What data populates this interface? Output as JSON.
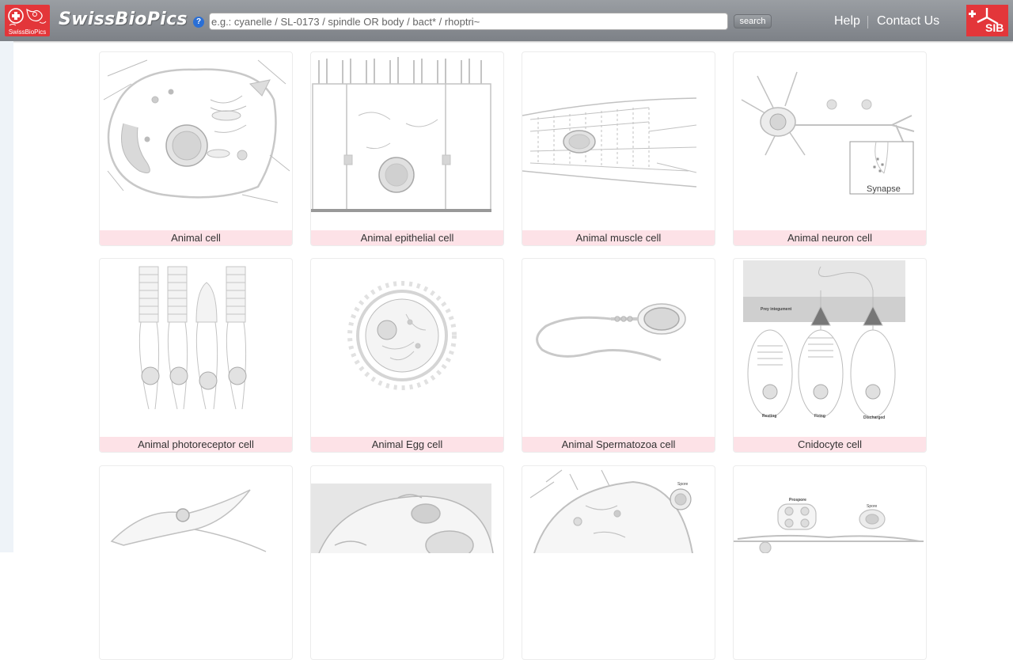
{
  "header": {
    "logo_caption": "SwissBioPics",
    "site_title": "SwissBioPics",
    "help_icon": "question-circle-icon",
    "search_placeholder": "e.g.: cyanelle / SL-0173 / spindle OR body / bact* / rhoptri~",
    "search_value": "",
    "search_button": "search",
    "nav": {
      "help": "Help",
      "contact": "Contact Us"
    },
    "sib_logo_text": "SIB"
  },
  "colors": {
    "header_bg": "#8c9096",
    "label_bg": "#fde2e7",
    "logo_red": "#e3363a"
  },
  "cells": [
    {
      "label": "Animal cell"
    },
    {
      "label": "Animal epithelial cell"
    },
    {
      "label": "Animal muscle cell"
    },
    {
      "label": "Animal neuron cell",
      "inset_text": "Synapse"
    },
    {
      "label": "Animal photoreceptor cell"
    },
    {
      "label": "Animal Egg cell"
    },
    {
      "label": "Animal Spermatozoa cell"
    },
    {
      "label": "Cnidocyte cell",
      "texts": [
        "Prey integument",
        "Resting",
        "Firing",
        "Discharged"
      ]
    },
    {
      "label": ""
    },
    {
      "label": ""
    },
    {
      "label": "",
      "texts": [
        "Spore"
      ]
    },
    {
      "label": "",
      "texts": [
        "Prospore",
        "Spore"
      ]
    }
  ]
}
